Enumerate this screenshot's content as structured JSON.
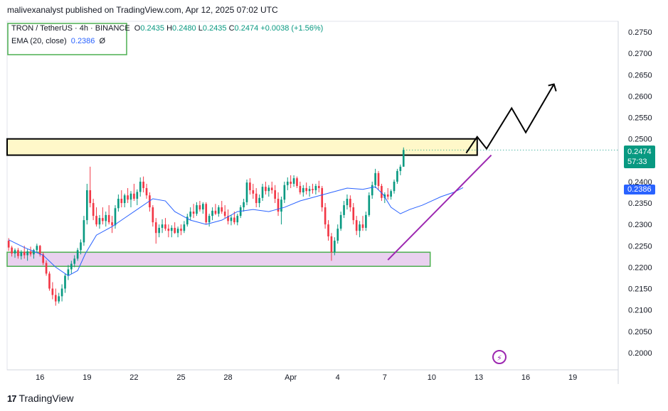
{
  "header": {
    "attribution": "malivexanalyst published on TradingView.com, Apr 12, 2025 07:02 UTC"
  },
  "legend": {
    "symbol": "TRON / TetherUS · 4h · BINANCE",
    "open_label": "O",
    "open": "0.2435",
    "high_label": "H",
    "high": "0.2480",
    "low_label": "L",
    "low": "0.2435",
    "close_label": "C",
    "close": "0.2474",
    "change": "+0.0038 (+1.56%)",
    "ema_label": "EMA (20, close)",
    "ema_value": "0.2386",
    "ema_suffix": "Ø"
  },
  "badges": {
    "price": "0.2474",
    "countdown": "57:33",
    "ema": "0.2386"
  },
  "footer": {
    "brand": "TradingView",
    "logo_glyph": "17"
  },
  "colors": {
    "up": "#089981",
    "down": "#f23645",
    "ema": "#2962ff",
    "resistance_fill": "#fff8c9",
    "support_fill": "#e9d1ef",
    "support_border": "#4caf50",
    "trendline": "#9c27b0",
    "projection": "#000000"
  },
  "icons": {
    "flash": "flash-icon"
  },
  "chart_data": {
    "type": "candlestick",
    "yticks": [
      "0.2750",
      "0.2700",
      "0.2650",
      "0.2600",
      "0.2550",
      "0.2500",
      "0.2450",
      "0.2400",
      "0.2350",
      "0.2300",
      "0.2250",
      "0.2200",
      "0.2150",
      "0.2100",
      "0.2050",
      "0.2000"
    ],
    "ylim": [
      0.196,
      0.2775
    ],
    "xticks": [
      "16",
      "19",
      "22",
      "25",
      "28",
      "Apr",
      "4",
      "7",
      "10",
      "13",
      "16",
      "19"
    ],
    "xtick_days": [
      16,
      19,
      22,
      25,
      28,
      32,
      35,
      38,
      41,
      44,
      47,
      50
    ],
    "xlim_days": [
      13.9,
      52.9
    ],
    "resistance_zone": [
      0.2462,
      0.25
    ],
    "support_zone": [
      0.2202,
      0.2235
    ],
    "trendline": {
      "from": [
        38.2,
        0.2217
      ],
      "to": [
        44.8,
        0.2462
      ]
    },
    "projection": [
      [
        43.2,
        0.2467
      ],
      [
        43.9,
        0.2505
      ],
      [
        44.5,
        0.2477
      ],
      [
        46.1,
        0.2572
      ],
      [
        47.0,
        0.2515
      ],
      [
        48.8,
        0.2628
      ],
      [
        48.9,
        0.261
      ],
      [
        49.0,
        0.263
      ],
      [
        48.6,
        0.2633
      ]
    ],
    "candles": [
      [
        0.2262,
        0.2268,
        0.2238,
        0.2246
      ],
      [
        0.2246,
        0.225,
        0.2225,
        0.2232
      ],
      [
        0.2232,
        0.2244,
        0.2222,
        0.224
      ],
      [
        0.224,
        0.2245,
        0.222,
        0.2226
      ],
      [
        0.2226,
        0.224,
        0.2218,
        0.2236
      ],
      [
        0.2236,
        0.225,
        0.222,
        0.2228
      ],
      [
        0.2228,
        0.2242,
        0.2215,
        0.2237
      ],
      [
        0.2237,
        0.2248,
        0.2225,
        0.223
      ],
      [
        0.223,
        0.2243,
        0.222,
        0.224
      ],
      [
        0.224,
        0.2255,
        0.2235,
        0.225
      ],
      [
        0.225,
        0.2252,
        0.2225,
        0.223
      ],
      [
        0.223,
        0.2235,
        0.2205,
        0.221
      ],
      [
        0.221,
        0.2216,
        0.218,
        0.2185
      ],
      [
        0.2185,
        0.219,
        0.2145,
        0.215
      ],
      [
        0.215,
        0.2165,
        0.2125,
        0.2135
      ],
      [
        0.2135,
        0.215,
        0.211,
        0.212
      ],
      [
        0.212,
        0.214,
        0.2115,
        0.2132
      ],
      [
        0.2132,
        0.216,
        0.212,
        0.215
      ],
      [
        0.215,
        0.2185,
        0.214,
        0.218
      ],
      [
        0.218,
        0.2205,
        0.217,
        0.2195
      ],
      [
        0.2195,
        0.2215,
        0.2185,
        0.2208
      ],
      [
        0.2208,
        0.2228,
        0.22,
        0.222
      ],
      [
        0.222,
        0.2245,
        0.2215,
        0.224
      ],
      [
        0.224,
        0.2265,
        0.223,
        0.2258
      ],
      [
        0.2258,
        0.232,
        0.225,
        0.231
      ],
      [
        0.231,
        0.2395,
        0.23,
        0.238
      ],
      [
        0.238,
        0.2435,
        0.234,
        0.235
      ],
      [
        0.235,
        0.236,
        0.231,
        0.232
      ],
      [
        0.232,
        0.234,
        0.2295,
        0.23
      ],
      [
        0.23,
        0.2322,
        0.229,
        0.2315
      ],
      [
        0.2315,
        0.234,
        0.23,
        0.2308
      ],
      [
        0.2308,
        0.233,
        0.2295,
        0.2322
      ],
      [
        0.2322,
        0.2345,
        0.23,
        0.2305
      ],
      [
        0.2305,
        0.232,
        0.228,
        0.2298
      ],
      [
        0.2298,
        0.2345,
        0.229,
        0.2338
      ],
      [
        0.2338,
        0.237,
        0.233,
        0.236
      ],
      [
        0.236,
        0.238,
        0.234,
        0.235
      ],
      [
        0.235,
        0.2372,
        0.234,
        0.2368
      ],
      [
        0.2368,
        0.2385,
        0.235,
        0.2358
      ],
      [
        0.2358,
        0.2378,
        0.234,
        0.2372
      ],
      [
        0.2372,
        0.2395,
        0.2355,
        0.236
      ],
      [
        0.236,
        0.2382,
        0.2345,
        0.2376
      ],
      [
        0.2376,
        0.241,
        0.2365,
        0.24
      ],
      [
        0.24,
        0.2412,
        0.2375,
        0.2385
      ],
      [
        0.2385,
        0.2395,
        0.236,
        0.2368
      ],
      [
        0.2368,
        0.2375,
        0.233,
        0.234
      ],
      [
        0.234,
        0.2345,
        0.2295,
        0.2305
      ],
      [
        0.2305,
        0.2315,
        0.2255,
        0.228
      ],
      [
        0.228,
        0.23,
        0.227,
        0.2292
      ],
      [
        0.2292,
        0.2312,
        0.228,
        0.23
      ],
      [
        0.23,
        0.2315,
        0.2285,
        0.229
      ],
      [
        0.229,
        0.23,
        0.227,
        0.2285
      ],
      [
        0.2285,
        0.2298,
        0.227,
        0.2292
      ],
      [
        0.2292,
        0.2305,
        0.2278,
        0.228
      ],
      [
        0.228,
        0.2295,
        0.227,
        0.229
      ],
      [
        0.229,
        0.23,
        0.2275,
        0.2285
      ],
      [
        0.2285,
        0.2308,
        0.228,
        0.23
      ],
      [
        0.23,
        0.2325,
        0.2295,
        0.2318
      ],
      [
        0.2318,
        0.234,
        0.231,
        0.233
      ],
      [
        0.233,
        0.2348,
        0.2315,
        0.2325
      ],
      [
        0.2325,
        0.2352,
        0.232,
        0.2345
      ],
      [
        0.2345,
        0.2355,
        0.233,
        0.2335
      ],
      [
        0.2335,
        0.2352,
        0.2325,
        0.2348
      ],
      [
        0.2348,
        0.2352,
        0.23,
        0.2305
      ],
      [
        0.2305,
        0.2325,
        0.2295,
        0.232
      ],
      [
        0.232,
        0.234,
        0.231,
        0.2332
      ],
      [
        0.2332,
        0.2348,
        0.2322,
        0.2325
      ],
      [
        0.2325,
        0.2345,
        0.2318,
        0.234
      ],
      [
        0.234,
        0.2355,
        0.2325,
        0.233
      ],
      [
        0.233,
        0.2345,
        0.2315,
        0.232
      ],
      [
        0.232,
        0.2335,
        0.23,
        0.2308
      ],
      [
        0.2308,
        0.2322,
        0.2298,
        0.2316
      ],
      [
        0.2316,
        0.233,
        0.23,
        0.2305
      ],
      [
        0.2305,
        0.2325,
        0.2298,
        0.232
      ],
      [
        0.232,
        0.2345,
        0.2315,
        0.234
      ],
      [
        0.234,
        0.236,
        0.233,
        0.2352
      ],
      [
        0.2352,
        0.2405,
        0.2345,
        0.2398
      ],
      [
        0.2398,
        0.2408,
        0.237,
        0.238
      ],
      [
        0.238,
        0.2395,
        0.236,
        0.2372
      ],
      [
        0.2372,
        0.2385,
        0.234,
        0.235
      ],
      [
        0.235,
        0.237,
        0.234,
        0.2362
      ],
      [
        0.2362,
        0.2395,
        0.2355,
        0.2388
      ],
      [
        0.2388,
        0.24,
        0.237,
        0.2378
      ],
      [
        0.2378,
        0.2392,
        0.2365,
        0.2386
      ],
      [
        0.2386,
        0.24,
        0.2372,
        0.238
      ],
      [
        0.238,
        0.2392,
        0.235,
        0.236
      ],
      [
        0.236,
        0.2375,
        0.232,
        0.233
      ],
      [
        0.233,
        0.2365,
        0.23,
        0.2358
      ],
      [
        0.2358,
        0.24,
        0.235,
        0.2392
      ],
      [
        0.2392,
        0.241,
        0.238,
        0.24
      ],
      [
        0.24,
        0.2415,
        0.2385,
        0.2395
      ],
      [
        0.2395,
        0.2415,
        0.2388,
        0.2408
      ],
      [
        0.2408,
        0.2412,
        0.2385,
        0.239
      ],
      [
        0.239,
        0.24,
        0.237,
        0.2375
      ],
      [
        0.2375,
        0.2392,
        0.2365,
        0.2385
      ],
      [
        0.2385,
        0.2398,
        0.237,
        0.2378
      ],
      [
        0.2378,
        0.239,
        0.2365,
        0.2383
      ],
      [
        0.2383,
        0.2395,
        0.2372,
        0.238
      ],
      [
        0.238,
        0.2395,
        0.237,
        0.239
      ],
      [
        0.239,
        0.2402,
        0.2375,
        0.2385
      ],
      [
        0.2385,
        0.239,
        0.233,
        0.234
      ],
      [
        0.234,
        0.235,
        0.229,
        0.23
      ],
      [
        0.23,
        0.231,
        0.2262,
        0.2272
      ],
      [
        0.2272,
        0.228,
        0.2215,
        0.2235
      ],
      [
        0.2235,
        0.227,
        0.2228,
        0.2262
      ],
      [
        0.2262,
        0.23,
        0.2255,
        0.229
      ],
      [
        0.229,
        0.233,
        0.2285,
        0.2322
      ],
      [
        0.2322,
        0.2355,
        0.2315,
        0.2345
      ],
      [
        0.2345,
        0.237,
        0.2335,
        0.236
      ],
      [
        0.236,
        0.2368,
        0.233,
        0.234
      ],
      [
        0.234,
        0.235,
        0.23,
        0.231
      ],
      [
        0.231,
        0.232,
        0.2275,
        0.2285
      ],
      [
        0.2285,
        0.2308,
        0.227,
        0.23
      ],
      [
        0.23,
        0.232,
        0.2285,
        0.2292
      ],
      [
        0.2292,
        0.233,
        0.2285,
        0.2322
      ],
      [
        0.2322,
        0.2375,
        0.2318,
        0.2368
      ],
      [
        0.2368,
        0.24,
        0.236,
        0.2392
      ],
      [
        0.2392,
        0.243,
        0.2385,
        0.242
      ],
      [
        0.242,
        0.2425,
        0.238,
        0.239
      ],
      [
        0.239,
        0.2395,
        0.2355,
        0.2362
      ],
      [
        0.2362,
        0.2375,
        0.235,
        0.237
      ],
      [
        0.237,
        0.2385,
        0.2358,
        0.2365
      ],
      [
        0.2365,
        0.2382,
        0.2358,
        0.2378
      ],
      [
        0.2378,
        0.2405,
        0.2372,
        0.24
      ],
      [
        0.24,
        0.243,
        0.2395,
        0.2425
      ],
      [
        0.2425,
        0.244,
        0.2415,
        0.2435
      ],
      [
        0.2435,
        0.248,
        0.2435,
        0.2474
      ]
    ],
    "candle_x_start": 14.0,
    "candle_x_step": 0.2,
    "ema": [
      [
        14.0,
        0.2264
      ],
      [
        15.0,
        0.2246
      ],
      [
        16.2,
        0.2228
      ],
      [
        17.0,
        0.22
      ],
      [
        17.8,
        0.218
      ],
      [
        18.4,
        0.2192
      ],
      [
        18.9,
        0.2232
      ],
      [
        19.6,
        0.2275
      ],
      [
        20.6,
        0.2295
      ],
      [
        21.4,
        0.2315
      ],
      [
        22.4,
        0.234
      ],
      [
        23.2,
        0.236
      ],
      [
        24.0,
        0.2355
      ],
      [
        24.6,
        0.233
      ],
      [
        25.6,
        0.231
      ],
      [
        26.6,
        0.23
      ],
      [
        27.6,
        0.231
      ],
      [
        28.6,
        0.233
      ],
      [
        29.6,
        0.2335
      ],
      [
        30.6,
        0.233
      ],
      [
        31.6,
        0.234
      ],
      [
        32.6,
        0.2355
      ],
      [
        33.6,
        0.2365
      ],
      [
        34.6,
        0.2375
      ],
      [
        35.6,
        0.2385
      ],
      [
        36.6,
        0.2382
      ],
      [
        37.4,
        0.2388
      ],
      [
        37.9,
        0.237
      ],
      [
        38.4,
        0.234
      ],
      [
        39.0,
        0.2325
      ],
      [
        39.6,
        0.2335
      ],
      [
        40.4,
        0.2345
      ],
      [
        41.0,
        0.2355
      ],
      [
        41.6,
        0.2365
      ],
      [
        42.4,
        0.2375
      ],
      [
        43.0,
        0.2386
      ]
    ]
  }
}
